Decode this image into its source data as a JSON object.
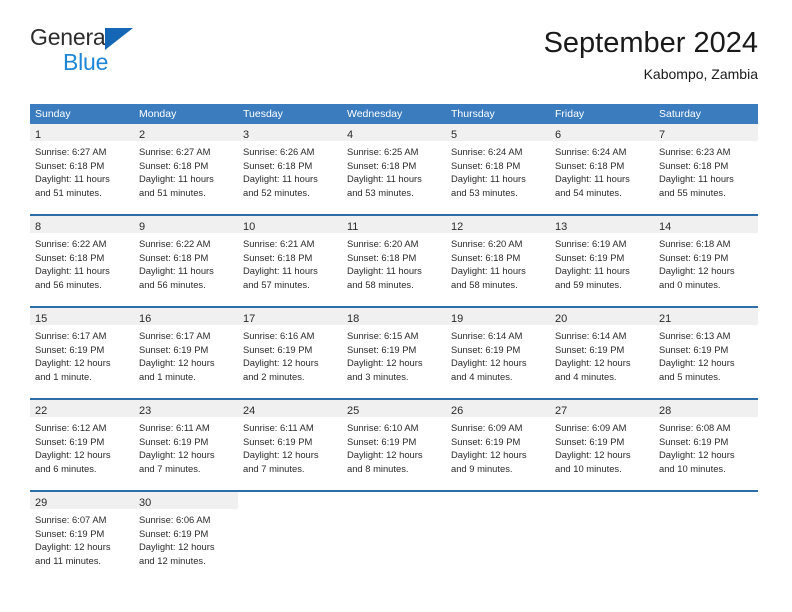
{
  "brand": {
    "name_top": "General",
    "name_bottom": "Blue",
    "triangle_icon": "brand-triangle-icon",
    "accent_dark": "#1567b5",
    "accent_light": "#1e86d6"
  },
  "header": {
    "title": "September 2024",
    "subtitle": "Kabompo, Zambia"
  },
  "theme": {
    "header_bg": "#3a7cbe",
    "row_border": "#2f6da9",
    "daynum_bg": "#f0f0f0",
    "text": "#2b2b2b"
  },
  "weekdays": [
    "Sunday",
    "Monday",
    "Tuesday",
    "Wednesday",
    "Thursday",
    "Friday",
    "Saturday"
  ],
  "weeks": [
    [
      {
        "day": "1",
        "sunrise": "Sunrise: 6:27 AM",
        "sunset": "Sunset: 6:18 PM",
        "daylight1": "Daylight: 11 hours",
        "daylight2": "and 51 minutes."
      },
      {
        "day": "2",
        "sunrise": "Sunrise: 6:27 AM",
        "sunset": "Sunset: 6:18 PM",
        "daylight1": "Daylight: 11 hours",
        "daylight2": "and 51 minutes."
      },
      {
        "day": "3",
        "sunrise": "Sunrise: 6:26 AM",
        "sunset": "Sunset: 6:18 PM",
        "daylight1": "Daylight: 11 hours",
        "daylight2": "and 52 minutes."
      },
      {
        "day": "4",
        "sunrise": "Sunrise: 6:25 AM",
        "sunset": "Sunset: 6:18 PM",
        "daylight1": "Daylight: 11 hours",
        "daylight2": "and 53 minutes."
      },
      {
        "day": "5",
        "sunrise": "Sunrise: 6:24 AM",
        "sunset": "Sunset: 6:18 PM",
        "daylight1": "Daylight: 11 hours",
        "daylight2": "and 53 minutes."
      },
      {
        "day": "6",
        "sunrise": "Sunrise: 6:24 AM",
        "sunset": "Sunset: 6:18 PM",
        "daylight1": "Daylight: 11 hours",
        "daylight2": "and 54 minutes."
      },
      {
        "day": "7",
        "sunrise": "Sunrise: 6:23 AM",
        "sunset": "Sunset: 6:18 PM",
        "daylight1": "Daylight: 11 hours",
        "daylight2": "and 55 minutes."
      }
    ],
    [
      {
        "day": "8",
        "sunrise": "Sunrise: 6:22 AM",
        "sunset": "Sunset: 6:18 PM",
        "daylight1": "Daylight: 11 hours",
        "daylight2": "and 56 minutes."
      },
      {
        "day": "9",
        "sunrise": "Sunrise: 6:22 AM",
        "sunset": "Sunset: 6:18 PM",
        "daylight1": "Daylight: 11 hours",
        "daylight2": "and 56 minutes."
      },
      {
        "day": "10",
        "sunrise": "Sunrise: 6:21 AM",
        "sunset": "Sunset: 6:18 PM",
        "daylight1": "Daylight: 11 hours",
        "daylight2": "and 57 minutes."
      },
      {
        "day": "11",
        "sunrise": "Sunrise: 6:20 AM",
        "sunset": "Sunset: 6:18 PM",
        "daylight1": "Daylight: 11 hours",
        "daylight2": "and 58 minutes."
      },
      {
        "day": "12",
        "sunrise": "Sunrise: 6:20 AM",
        "sunset": "Sunset: 6:18 PM",
        "daylight1": "Daylight: 11 hours",
        "daylight2": "and 58 minutes."
      },
      {
        "day": "13",
        "sunrise": "Sunrise: 6:19 AM",
        "sunset": "Sunset: 6:19 PM",
        "daylight1": "Daylight: 11 hours",
        "daylight2": "and 59 minutes."
      },
      {
        "day": "14",
        "sunrise": "Sunrise: 6:18 AM",
        "sunset": "Sunset: 6:19 PM",
        "daylight1": "Daylight: 12 hours",
        "daylight2": "and 0 minutes."
      }
    ],
    [
      {
        "day": "15",
        "sunrise": "Sunrise: 6:17 AM",
        "sunset": "Sunset: 6:19 PM",
        "daylight1": "Daylight: 12 hours",
        "daylight2": "and 1 minute."
      },
      {
        "day": "16",
        "sunrise": "Sunrise: 6:17 AM",
        "sunset": "Sunset: 6:19 PM",
        "daylight1": "Daylight: 12 hours",
        "daylight2": "and 1 minute."
      },
      {
        "day": "17",
        "sunrise": "Sunrise: 6:16 AM",
        "sunset": "Sunset: 6:19 PM",
        "daylight1": "Daylight: 12 hours",
        "daylight2": "and 2 minutes."
      },
      {
        "day": "18",
        "sunrise": "Sunrise: 6:15 AM",
        "sunset": "Sunset: 6:19 PM",
        "daylight1": "Daylight: 12 hours",
        "daylight2": "and 3 minutes."
      },
      {
        "day": "19",
        "sunrise": "Sunrise: 6:14 AM",
        "sunset": "Sunset: 6:19 PM",
        "daylight1": "Daylight: 12 hours",
        "daylight2": "and 4 minutes."
      },
      {
        "day": "20",
        "sunrise": "Sunrise: 6:14 AM",
        "sunset": "Sunset: 6:19 PM",
        "daylight1": "Daylight: 12 hours",
        "daylight2": "and 4 minutes."
      },
      {
        "day": "21",
        "sunrise": "Sunrise: 6:13 AM",
        "sunset": "Sunset: 6:19 PM",
        "daylight1": "Daylight: 12 hours",
        "daylight2": "and 5 minutes."
      }
    ],
    [
      {
        "day": "22",
        "sunrise": "Sunrise: 6:12 AM",
        "sunset": "Sunset: 6:19 PM",
        "daylight1": "Daylight: 12 hours",
        "daylight2": "and 6 minutes."
      },
      {
        "day": "23",
        "sunrise": "Sunrise: 6:11 AM",
        "sunset": "Sunset: 6:19 PM",
        "daylight1": "Daylight: 12 hours",
        "daylight2": "and 7 minutes."
      },
      {
        "day": "24",
        "sunrise": "Sunrise: 6:11 AM",
        "sunset": "Sunset: 6:19 PM",
        "daylight1": "Daylight: 12 hours",
        "daylight2": "and 7 minutes."
      },
      {
        "day": "25",
        "sunrise": "Sunrise: 6:10 AM",
        "sunset": "Sunset: 6:19 PM",
        "daylight1": "Daylight: 12 hours",
        "daylight2": "and 8 minutes."
      },
      {
        "day": "26",
        "sunrise": "Sunrise: 6:09 AM",
        "sunset": "Sunset: 6:19 PM",
        "daylight1": "Daylight: 12 hours",
        "daylight2": "and 9 minutes."
      },
      {
        "day": "27",
        "sunrise": "Sunrise: 6:09 AM",
        "sunset": "Sunset: 6:19 PM",
        "daylight1": "Daylight: 12 hours",
        "daylight2": "and 10 minutes."
      },
      {
        "day": "28",
        "sunrise": "Sunrise: 6:08 AM",
        "sunset": "Sunset: 6:19 PM",
        "daylight1": "Daylight: 12 hours",
        "daylight2": "and 10 minutes."
      }
    ],
    [
      {
        "day": "29",
        "sunrise": "Sunrise: 6:07 AM",
        "sunset": "Sunset: 6:19 PM",
        "daylight1": "Daylight: 12 hours",
        "daylight2": "and 11 minutes."
      },
      {
        "day": "30",
        "sunrise": "Sunrise: 6:06 AM",
        "sunset": "Sunset: 6:19 PM",
        "daylight1": "Daylight: 12 hours",
        "daylight2": "and 12 minutes."
      },
      {
        "day": "",
        "sunrise": "",
        "sunset": "",
        "daylight1": "",
        "daylight2": "",
        "empty": true
      },
      {
        "day": "",
        "sunrise": "",
        "sunset": "",
        "daylight1": "",
        "daylight2": "",
        "empty": true
      },
      {
        "day": "",
        "sunrise": "",
        "sunset": "",
        "daylight1": "",
        "daylight2": "",
        "empty": true
      },
      {
        "day": "",
        "sunrise": "",
        "sunset": "",
        "daylight1": "",
        "daylight2": "",
        "empty": true
      },
      {
        "day": "",
        "sunrise": "",
        "sunset": "",
        "daylight1": "",
        "daylight2": "",
        "empty": true
      }
    ]
  ]
}
